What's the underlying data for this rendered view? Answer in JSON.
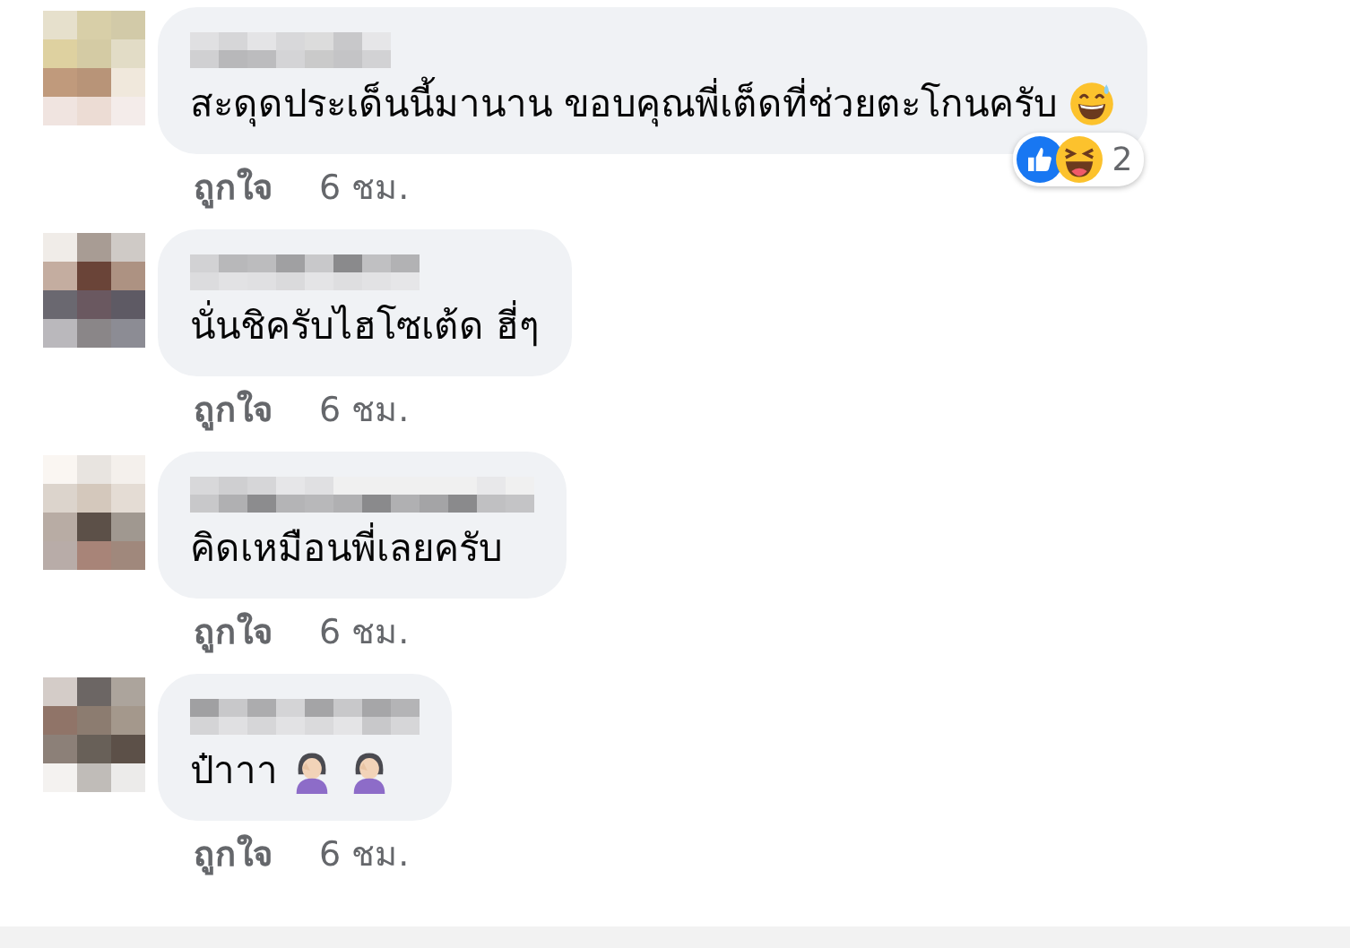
{
  "comments": [
    {
      "text": "สะดุดประเด็นนี้มานาน ขอบคุณพี่เต็ดที่ช่วยตะโกนครับ",
      "emojis": [
        {
          "kind": "sweat-smile"
        }
      ],
      "reactions": {
        "count": "2"
      },
      "like_label": "ถูกใจ",
      "time": "6 ชม."
    },
    {
      "text": "นั่นชิครับไฮโซเต้ด ฮี่ๆ",
      "like_label": "ถูกใจ",
      "time": "6 ชม."
    },
    {
      "text": "คิดเหมือนพี่เลยครับ",
      "like_label": "ถูกใจ",
      "time": "6 ชม."
    },
    {
      "text": "ป๋าาา",
      "emojis": [
        {
          "kind": "facepalm"
        },
        {
          "kind": "facepalm"
        }
      ],
      "like_label": "ถูกใจ",
      "time": "6 ชม."
    }
  ]
}
